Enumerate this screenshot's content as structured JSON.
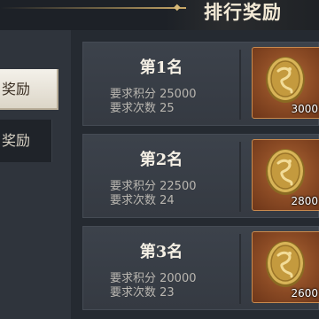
{
  "header": {
    "title": "排行奖励"
  },
  "tabs": [
    {
      "label": "奖励",
      "active": true
    },
    {
      "label": "奖励",
      "active": false
    }
  ],
  "rewards": [
    {
      "rank": "第1名",
      "score_req": "要求积分 25000",
      "count_req": "要求次数 25",
      "amount": "3000"
    },
    {
      "rank": "第2名",
      "score_req": "要求积分 22500",
      "count_req": "要求次数 24",
      "amount": "2800"
    },
    {
      "rank": "第3名",
      "score_req": "要求积分 20000",
      "count_req": "要求次数 23",
      "amount": "2600"
    }
  ],
  "icons": {
    "reward_icon": "gold-dragon-coin-icon"
  },
  "colors": {
    "accent_gold": "#d6b878",
    "reward_bg": "#8a4a24"
  }
}
